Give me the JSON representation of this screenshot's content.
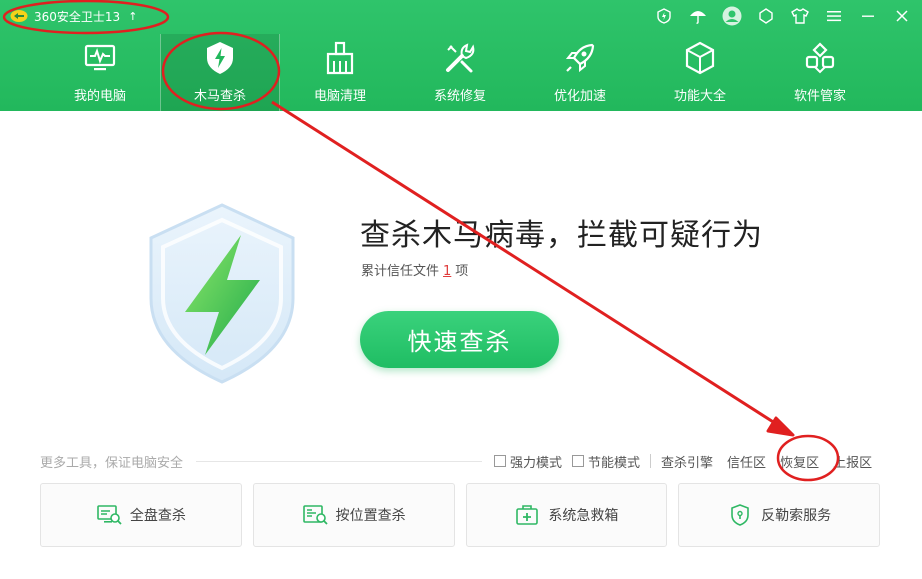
{
  "app": {
    "title": "360安全卫士13",
    "update_arrow": "↑"
  },
  "window_controls": [
    {
      "name": "shield-icon"
    },
    {
      "name": "umbrella-icon"
    },
    {
      "name": "avatar-icon"
    },
    {
      "name": "skin-icon"
    },
    {
      "name": "shirt-icon"
    },
    {
      "name": "menu-icon"
    },
    {
      "name": "minimize-icon"
    },
    {
      "name": "close-icon"
    }
  ],
  "nav": {
    "items": [
      {
        "label": "我的电脑",
        "icon": "monitor-icon",
        "active": false
      },
      {
        "label": "木马查杀",
        "icon": "lightning-shield-icon",
        "active": true
      },
      {
        "label": "电脑清理",
        "icon": "broom-icon",
        "active": false
      },
      {
        "label": "系统修复",
        "icon": "wrench-icon",
        "active": false
      },
      {
        "label": "优化加速",
        "icon": "rocket-icon",
        "active": false
      },
      {
        "label": "功能大全",
        "icon": "cube-icon",
        "active": false
      },
      {
        "label": "软件管家",
        "icon": "apps-icon",
        "active": false
      }
    ]
  },
  "hero": {
    "title": "查杀木马病毒，拦截可疑行为",
    "sub_prefix": "累计信任文件",
    "trust_count": "1",
    "sub_suffix": "项",
    "scan_button": "快速查杀"
  },
  "tools": {
    "caption": "更多工具，保证电脑安全",
    "options": [
      {
        "label": "强力模式",
        "checked": false
      },
      {
        "label": "节能模式",
        "checked": false
      }
    ],
    "links": [
      "查杀引擎",
      "信任区",
      "恢复区",
      "上报区"
    ],
    "cards": [
      {
        "label": "全盘查杀",
        "icon": "full-scan-icon"
      },
      {
        "label": "按位置查杀",
        "icon": "location-scan-icon"
      },
      {
        "label": "系统急救箱",
        "icon": "first-aid-icon"
      },
      {
        "label": "反勒索服务",
        "icon": "ransomware-shield-icon"
      }
    ]
  },
  "colors": {
    "brand_green": "#22b85c",
    "annotation_red": "#e02020"
  }
}
